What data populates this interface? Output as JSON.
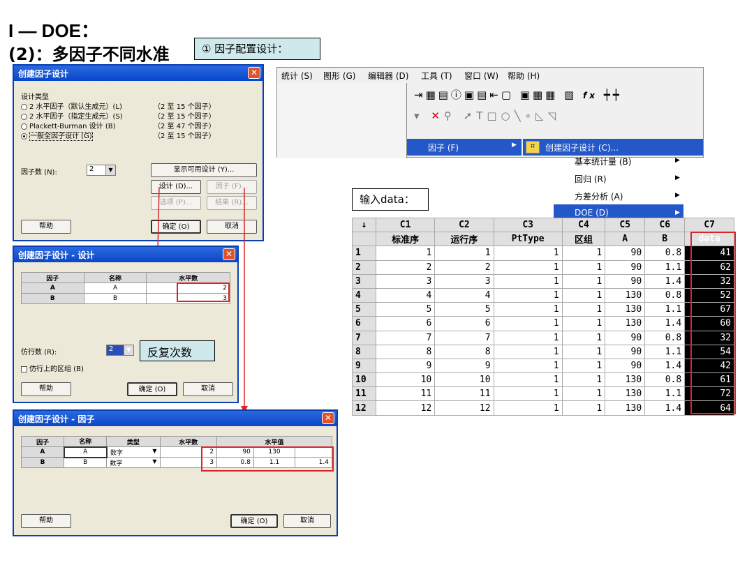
{
  "heading": {
    "line1": "I — DOE：",
    "line2": "(2)：多因子不同水准"
  },
  "callouts": {
    "factor_config": "① 因子配置设计：",
    "input_data": "输入data：",
    "replicates": "反复次数"
  },
  "dialog1": {
    "title": "创建因子设计",
    "design_type_label": "设计类型",
    "options": [
      {
        "label": "2 水平因子（默认生成元）(L)",
        "range": "（2 至 15 个因子）",
        "selected": false
      },
      {
        "label": "2 水平因子（指定生成元）(S)",
        "range": "（2 至 15 个因子）",
        "selected": false
      },
      {
        "label": "Plackett-Burman 设计 (B)",
        "range": "（2 至 47 个因子）",
        "selected": false
      },
      {
        "label": "一般全因子设计 (G)",
        "range": "（2 至 15 个因子）",
        "selected": true
      }
    ],
    "num_factors_label": "因子数 (N):",
    "num_factors_value": "2",
    "buttons": {
      "show_designs": "显示可用设计 (Y)...",
      "design": "设计 (D)...",
      "factors": "因子 (F)...",
      "options": "选项 (P)...",
      "results": "结果 (R)...",
      "help": "帮助",
      "ok": "确定 (O)",
      "cancel": "取消"
    }
  },
  "dialog2": {
    "title": "创建因子设计 - 设计",
    "columns": [
      "因子",
      "名称",
      "水平数"
    ],
    "rows": [
      [
        "A",
        "A",
        "2"
      ],
      [
        "B",
        "B",
        "3"
      ]
    ],
    "replicates_label": "仿行数 (R):",
    "replicates_value": "2",
    "block_label": "仿行上的区组 (B)",
    "buttons": {
      "help": "帮助",
      "ok": "确定 (O)",
      "cancel": "取消"
    }
  },
  "dialog3": {
    "title": "创建因子设计 - 因子",
    "columns": [
      "因子",
      "名称",
      "类型",
      "水平数",
      "水平值"
    ],
    "rows": [
      {
        "factor": "A",
        "name": "A",
        "type": "数字",
        "levels": "2",
        "values": [
          "90",
          "130",
          ""
        ]
      },
      {
        "factor": "B",
        "name": "B",
        "type": "数字",
        "levels": "3",
        "values": [
          "0.8",
          "1.1",
          "1.4"
        ]
      }
    ],
    "buttons": {
      "help": "帮助",
      "ok": "确定 (O)",
      "cancel": "取消"
    }
  },
  "menubar": {
    "items": [
      "统计 (S)",
      "图形 (G)",
      "编辑器 (D)",
      "工具 (T)",
      "窗口 (W)",
      "帮助 (H)"
    ],
    "submenu": [
      "基本统计量 (B)",
      "回归 (R)",
      "方差分析 (A)",
      "DOE (D)"
    ],
    "doe_submenu": "因子 (F)",
    "factor_submenu": "创建因子设计 (C)...",
    "fx_icon": "fx"
  },
  "worksheet": {
    "col_ids": [
      "↓",
      "C1",
      "C2",
      "C3",
      "C4",
      "C5",
      "C6",
      "C7"
    ],
    "col_names": [
      "",
      "标准序",
      "运行序",
      "PtType",
      "区组",
      "A",
      "B",
      "data"
    ],
    "rows": [
      [
        "1",
        "1",
        "1",
        "1",
        "1",
        "90",
        "0.8",
        "41"
      ],
      [
        "2",
        "2",
        "2",
        "1",
        "1",
        "90",
        "1.1",
        "62"
      ],
      [
        "3",
        "3",
        "3",
        "1",
        "1",
        "90",
        "1.4",
        "32"
      ],
      [
        "4",
        "4",
        "4",
        "1",
        "1",
        "130",
        "0.8",
        "52"
      ],
      [
        "5",
        "5",
        "5",
        "1",
        "1",
        "130",
        "1.1",
        "67"
      ],
      [
        "6",
        "6",
        "6",
        "1",
        "1",
        "130",
        "1.4",
        "60"
      ],
      [
        "7",
        "7",
        "7",
        "1",
        "1",
        "90",
        "0.8",
        "32"
      ],
      [
        "8",
        "8",
        "8",
        "1",
        "1",
        "90",
        "1.1",
        "54"
      ],
      [
        "9",
        "9",
        "9",
        "1",
        "1",
        "90",
        "1.4",
        "42"
      ],
      [
        "10",
        "10",
        "10",
        "1",
        "1",
        "130",
        "0.8",
        "61"
      ],
      [
        "11",
        "11",
        "11",
        "1",
        "1",
        "130",
        "1.1",
        "72"
      ],
      [
        "12",
        "12",
        "12",
        "1",
        "1",
        "130",
        "1.4",
        "64"
      ]
    ]
  }
}
